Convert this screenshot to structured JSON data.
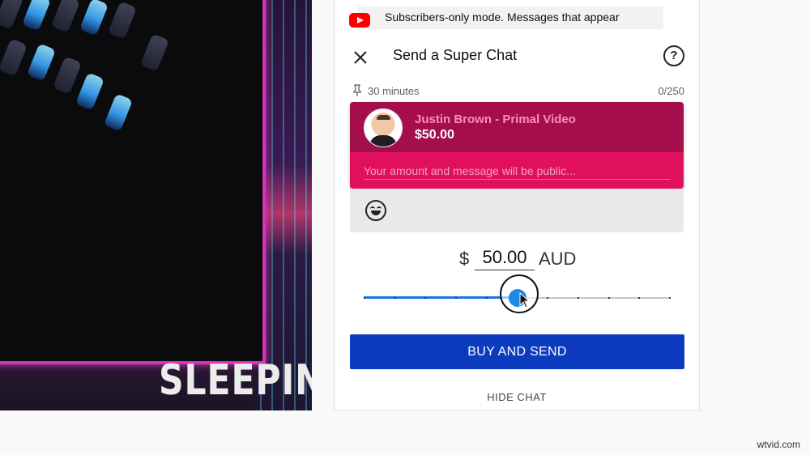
{
  "video": {
    "overlay_text": "SLEEPING"
  },
  "banner": {
    "text": "Subscribers-only mode. Messages that appear"
  },
  "super_chat": {
    "title": "Send a Super Chat",
    "close_icon": "close-icon",
    "help_icon": "help-icon",
    "help_glyph": "?",
    "duration": "30 minutes",
    "char_counter": "0/250",
    "author": "Justin Brown - Primal Video",
    "amount_display": "$50.00",
    "message_placeholder": "Your amount and message will be public...",
    "emoji_icon": "emoji-icon",
    "currency_symbol": "$",
    "amount_value": "50.00",
    "currency_code": "AUD",
    "slider_level": 0.5,
    "slider_ticks": 11,
    "buy_button": "BUY AND SEND",
    "hide_chat": "HIDE CHAT",
    "colors": {
      "card_top": "#a50e4d",
      "card_bottom": "#e0105d",
      "button": "#0d3bbf",
      "slider_fill": "#1a73e8"
    }
  },
  "watermark": "wtvid.com"
}
